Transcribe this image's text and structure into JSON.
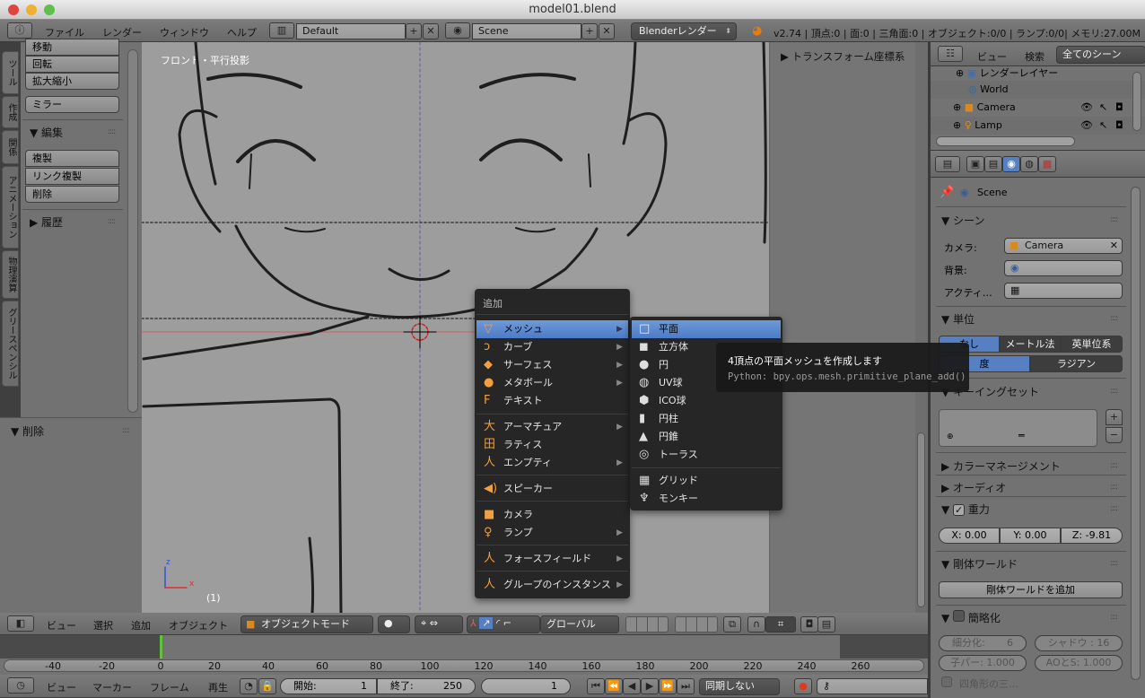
{
  "window": {
    "title": "model01.blend"
  },
  "info_header": {
    "menus": [
      "ファイル",
      "レンダー",
      "ウィンドウ",
      "ヘルプ"
    ],
    "layout": "Default",
    "scene": "Scene",
    "engine": "Blenderレンダー",
    "stats": "v2.74 | 頂点:0 | 面:0 | 三角面:0 | オブジェクト:0/0 | ランプ:0/0| メモリ:27.00M"
  },
  "tool_shelf": {
    "tabs": [
      "ツール",
      "作成",
      "関係",
      "アニメーション",
      "物理演算",
      "グリースペンシル"
    ],
    "transform_buttons": [
      "移動",
      "回転",
      "拡大縮小"
    ],
    "mirror": "ミラー",
    "edit_header": "編集",
    "edit_buttons": [
      "複製",
      "リンク複製",
      "削除"
    ],
    "history_header": "履歴",
    "operator_header": "削除"
  },
  "viewport": {
    "view_label": "フロント・平行投影",
    "frame_label": "(1)",
    "axis_z": "z",
    "axis_x": "x",
    "npanel_header": "トランスフォーム座標系"
  },
  "add_menu": {
    "title": "追加",
    "items": [
      {
        "label": "メッシュ",
        "icon": "mesh-icon",
        "sub": true,
        "active": true
      },
      {
        "label": "カーブ",
        "icon": "curve-icon",
        "sub": true
      },
      {
        "label": "サーフェス",
        "icon": "surface-icon",
        "sub": true
      },
      {
        "label": "メタボール",
        "icon": "metaball-icon",
        "sub": true
      },
      {
        "label": "テキスト",
        "icon": "text-icon",
        "sub": false
      },
      {
        "label": "アーマチュア",
        "icon": "armature-icon",
        "sub": true
      },
      {
        "label": "ラティス",
        "icon": "lattice-icon",
        "sub": false
      },
      {
        "label": "エンプティ",
        "icon": "empty-icon",
        "sub": true
      },
      {
        "label": "スピーカー",
        "icon": "speaker-icon",
        "sub": false
      },
      {
        "label": "カメラ",
        "icon": "camera-icon",
        "sub": false
      },
      {
        "label": "ランプ",
        "icon": "lamp-icon",
        "sub": true
      },
      {
        "label": "フォースフィールド",
        "icon": "forcefield-icon",
        "sub": true
      },
      {
        "label": "グループのインスタンス",
        "icon": "group-instance-icon",
        "sub": true
      }
    ],
    "mesh_submenu": [
      "平面",
      "立方体",
      "円",
      "UV球",
      "ICO球",
      "円柱",
      "円錐",
      "トーラス",
      "グリッド",
      "モンキー"
    ],
    "tooltip": {
      "title": "4頂点の平面メッシュを作成します",
      "python": "Python: bpy.ops.mesh.primitive_plane_add()"
    }
  },
  "view3d_header": {
    "menus": [
      "ビュー",
      "選択",
      "追加",
      "オブジェクト"
    ],
    "mode": "オブジェクトモード",
    "orientation": "グローバル"
  },
  "timeline": {
    "ticks": [
      "-40",
      "-20",
      "0",
      "20",
      "40",
      "60",
      "80",
      "100",
      "120",
      "140",
      "160",
      "180",
      "200",
      "220",
      "240",
      "260"
    ],
    "current_frame_value": 1,
    "header": {
      "menus": [
        "ビュー",
        "マーカー",
        "フレーム",
        "再生"
      ],
      "start_label": "開始:",
      "start": "1",
      "end_label": "終了:",
      "end": "250",
      "current": "1",
      "sync": "同期しない"
    }
  },
  "outliner": {
    "menus": [
      "ビュー",
      "検索"
    ],
    "filter": "全てのシーン",
    "items": [
      "レンダーレイヤー",
      "World",
      "Camera",
      "Lamp"
    ]
  },
  "properties": {
    "context": "Scene",
    "scene_header": "シーン",
    "camera_label": "カメラ:",
    "camera_value": "Camera",
    "background_label": "背景:",
    "active_label": "アクティ…",
    "units_header": "単位",
    "unit_systems": [
      "なし",
      "メートル法",
      "英単位系"
    ],
    "rotation_units": [
      "度",
      "ラジアン"
    ],
    "keying_header": "キーイングセット",
    "color_mgmt_header": "カラーマネージメント",
    "audio_header": "オーディオ",
    "gravity_header": "重力",
    "gravity_checked": true,
    "gravity": [
      "X: 0.00",
      "Y: 0.00",
      "Z: -9.81"
    ],
    "rigid_header": "剛体ワールド",
    "rigid_add": "剛体ワールドを追加",
    "simplify_header": "簡略化",
    "simplify_checked": false,
    "simplify_fields": [
      "細分化:",
      "6",
      "シャドウ : 16",
      "子パー: 1.000",
      "AOとS: 1.000"
    ],
    "quad_label": "四角形の三…"
  },
  "colors": {
    "accent": "#5680c2",
    "menu_bg": "#262626",
    "viewport_bg": "#9d9d9d"
  }
}
